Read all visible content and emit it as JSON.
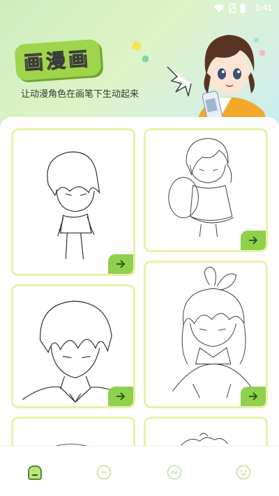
{
  "status_bar": {
    "time": "1:41"
  },
  "header": {
    "title": "画漫画",
    "subtitle": "让动漫角色在画笔下生动起来"
  },
  "cards": [
    {
      "name": "card-boy-chibi",
      "action": "arrow-right-icon"
    },
    {
      "name": "card-girl-chibi",
      "action": "arrow-right-icon"
    },
    {
      "name": "card-boy-portrait",
      "action": "arrow-right-icon"
    },
    {
      "name": "card-girl-ribbon",
      "action": "arrow-right-icon"
    },
    {
      "name": "card-partial-left",
      "action": ""
    },
    {
      "name": "card-partial-right",
      "action": ""
    }
  ],
  "nav": [
    {
      "icon": "home-icon",
      "active": true
    },
    {
      "icon": "circle-dot-icon",
      "active": false
    },
    {
      "icon": "wave-icon",
      "active": false
    },
    {
      "icon": "smile-icon",
      "active": false
    }
  ],
  "colors": {
    "accent": "#8fd14c",
    "card_border": "#e9f1a6",
    "nav_inactive": "#c7e3a7",
    "nav_active": "#7cc33a"
  }
}
